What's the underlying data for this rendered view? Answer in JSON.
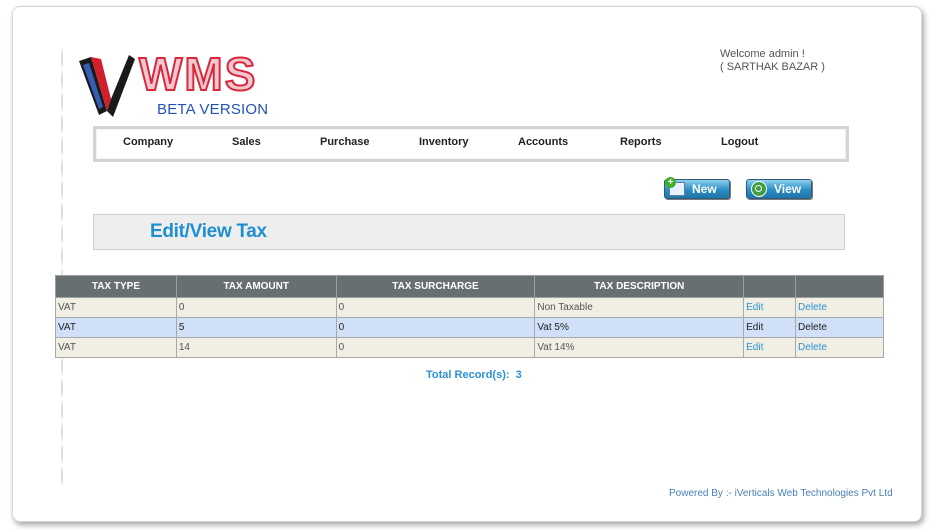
{
  "logo": {
    "wordmark": "WMS",
    "tagline": "BETA VERSION"
  },
  "welcome": {
    "line1": "Welcome admin !",
    "line2": "( SARTHAK BAZAR )"
  },
  "nav": [
    {
      "label": "Company"
    },
    {
      "label": "Sales"
    },
    {
      "label": "Purchase"
    },
    {
      "label": "Inventory"
    },
    {
      "label": "Accounts"
    },
    {
      "label": "Reports"
    },
    {
      "label": "Logout"
    }
  ],
  "actions": {
    "new_label": "New",
    "view_label": "View"
  },
  "page_title": "Edit/View Tax",
  "table": {
    "headers": [
      "TAX TYPE",
      "TAX AMOUNT",
      "TAX SURCHARGE",
      "TAX DESCRIPTION",
      "",
      ""
    ],
    "rows": [
      {
        "type": "VAT",
        "amount": "0",
        "surcharge": "0",
        "description": "Non Taxable",
        "edit": "Edit",
        "delete": "Delete"
      },
      {
        "type": "VAT",
        "amount": "5",
        "surcharge": "0",
        "description": "Vat 5%",
        "edit": "Edit",
        "delete": "Delete"
      },
      {
        "type": "VAT",
        "amount": "14",
        "surcharge": "0",
        "description": "Vat 14%",
        "edit": "Edit",
        "delete": "Delete"
      }
    ]
  },
  "total": {
    "label": "Total Record(s):",
    "count": "3"
  },
  "footer": {
    "powered_by": "Powered By :- iVerticals Web Technologies Pvt Ltd"
  },
  "colors": {
    "accent": "#1e8fd0",
    "table_header": "#686f70",
    "row_alt": "#f1eee4",
    "row_selected": "#cfe0f8",
    "logo_red": "#d8283c"
  }
}
